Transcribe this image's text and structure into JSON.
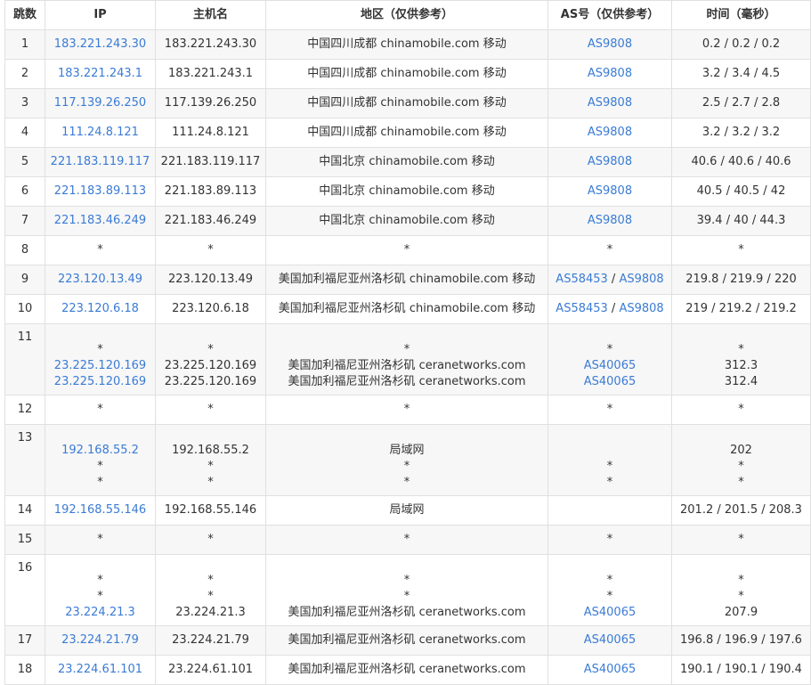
{
  "headers": {
    "hop": "跳数",
    "ip": "IP",
    "host": "主机名",
    "region": "地区（仅供参考）",
    "asn": "AS号（仅供参考）",
    "time": "时间（毫秒）"
  },
  "colors": {
    "link": "#3a7bd5",
    "row_alt": "#f7f7f7",
    "border": "#e0e0e0"
  },
  "rows": [
    {
      "hop": "1",
      "lines": [
        {
          "ip": "183.221.243.30",
          "host": "183.221.243.30",
          "region": "中国四川成都 chinamobile.com 移动",
          "as": [
            "AS9808"
          ],
          "time": "0.2 / 0.2 / 0.2"
        }
      ]
    },
    {
      "hop": "2",
      "lines": [
        {
          "ip": "183.221.243.1",
          "host": "183.221.243.1",
          "region": "中国四川成都 chinamobile.com 移动",
          "as": [
            "AS9808"
          ],
          "time": "3.2 / 3.4 / 4.5"
        }
      ]
    },
    {
      "hop": "3",
      "lines": [
        {
          "ip": "117.139.26.250",
          "host": "117.139.26.250",
          "region": "中国四川成都 chinamobile.com 移动",
          "as": [
            "AS9808"
          ],
          "time": "2.5 / 2.7 / 2.8"
        }
      ]
    },
    {
      "hop": "4",
      "lines": [
        {
          "ip": "111.24.8.121",
          "host": "111.24.8.121",
          "region": "中国四川成都 chinamobile.com 移动",
          "as": [
            "AS9808"
          ],
          "time": "3.2 / 3.2 / 3.2"
        }
      ]
    },
    {
      "hop": "5",
      "lines": [
        {
          "ip": "221.183.119.117",
          "host": "221.183.119.117",
          "region": "中国北京 chinamobile.com 移动",
          "as": [
            "AS9808"
          ],
          "time": "40.6 / 40.6 / 40.6"
        }
      ]
    },
    {
      "hop": "6",
      "lines": [
        {
          "ip": "221.183.89.113",
          "host": "221.183.89.113",
          "region": "中国北京 chinamobile.com 移动",
          "as": [
            "AS9808"
          ],
          "time": "40.5 / 40.5 / 42"
        }
      ]
    },
    {
      "hop": "7",
      "lines": [
        {
          "ip": "221.183.46.249",
          "host": "221.183.46.249",
          "region": "中国北京 chinamobile.com 移动",
          "as": [
            "AS9808"
          ],
          "time": "39.4 / 40 / 44.3"
        }
      ]
    },
    {
      "hop": "8",
      "lines": [
        {
          "ip": "*",
          "host": "*",
          "region": "*",
          "as": [
            "*"
          ],
          "time": "*"
        }
      ]
    },
    {
      "hop": "9",
      "lines": [
        {
          "ip": "223.120.13.49",
          "host": "223.120.13.49",
          "region": "美国加利福尼亚州洛杉矶 chinamobile.com 移动",
          "as": [
            "AS58453",
            "AS9808"
          ],
          "time": "219.8 / 219.9 / 220"
        }
      ]
    },
    {
      "hop": "10",
      "lines": [
        {
          "ip": "223.120.6.18",
          "host": "223.120.6.18",
          "region": "美国加利福尼亚州洛杉矶 chinamobile.com 移动",
          "as": [
            "AS58453",
            "AS9808"
          ],
          "time": "219 / 219.2 / 219.2"
        }
      ]
    },
    {
      "hop": "11",
      "lines": [
        {
          "ip": "*",
          "host": "*",
          "region": "*",
          "as": [
            "*"
          ],
          "time": "*"
        },
        {
          "ip": "23.225.120.169",
          "host": "23.225.120.169",
          "region": "美国加利福尼亚州洛杉矶 ceranetworks.com",
          "as": [
            "AS40065"
          ],
          "time": "312.3"
        },
        {
          "ip": "23.225.120.169",
          "host": "23.225.120.169",
          "region": "美国加利福尼亚州洛杉矶 ceranetworks.com",
          "as": [
            "AS40065"
          ],
          "time": "312.4"
        }
      ]
    },
    {
      "hop": "12",
      "lines": [
        {
          "ip": "*",
          "host": "*",
          "region": "*",
          "as": [
            "*"
          ],
          "time": "*"
        }
      ]
    },
    {
      "hop": "13",
      "lines": [
        {
          "ip": "192.168.55.2",
          "host": "192.168.55.2",
          "region": "局域网",
          "as": [],
          "time": "202"
        },
        {
          "ip": "*",
          "host": "*",
          "region": "*",
          "as": [
            "*"
          ],
          "time": "*"
        },
        {
          "ip": "*",
          "host": "*",
          "region": "*",
          "as": [
            "*"
          ],
          "time": "*"
        }
      ]
    },
    {
      "hop": "14",
      "lines": [
        {
          "ip": "192.168.55.146",
          "host": "192.168.55.146",
          "region": "局域网",
          "as": [],
          "time": "201.2 / 201.5 / 208.3"
        }
      ]
    },
    {
      "hop": "15",
      "lines": [
        {
          "ip": "*",
          "host": "*",
          "region": "*",
          "as": [
            "*"
          ],
          "time": "*"
        }
      ]
    },
    {
      "hop": "16",
      "lines": [
        {
          "ip": "*",
          "host": "*",
          "region": "*",
          "as": [
            "*"
          ],
          "time": "*"
        },
        {
          "ip": "*",
          "host": "*",
          "region": "*",
          "as": [
            "*"
          ],
          "time": "*"
        },
        {
          "ip": "23.224.21.3",
          "host": "23.224.21.3",
          "region": "美国加利福尼亚州洛杉矶 ceranetworks.com",
          "as": [
            "AS40065"
          ],
          "time": "207.9"
        }
      ]
    },
    {
      "hop": "17",
      "lines": [
        {
          "ip": "23.224.21.79",
          "host": "23.224.21.79",
          "region": "美国加利福尼亚州洛杉矶 ceranetworks.com",
          "as": [
            "AS40065"
          ],
          "time": "196.8 / 196.9 / 197.6"
        }
      ]
    },
    {
      "hop": "18",
      "lines": [
        {
          "ip": "23.224.61.101",
          "host": "23.224.61.101",
          "region": "美国加利福尼亚州洛杉矶 ceranetworks.com",
          "as": [
            "AS40065"
          ],
          "time": "190.1 / 190.1 / 190.4"
        }
      ]
    }
  ]
}
